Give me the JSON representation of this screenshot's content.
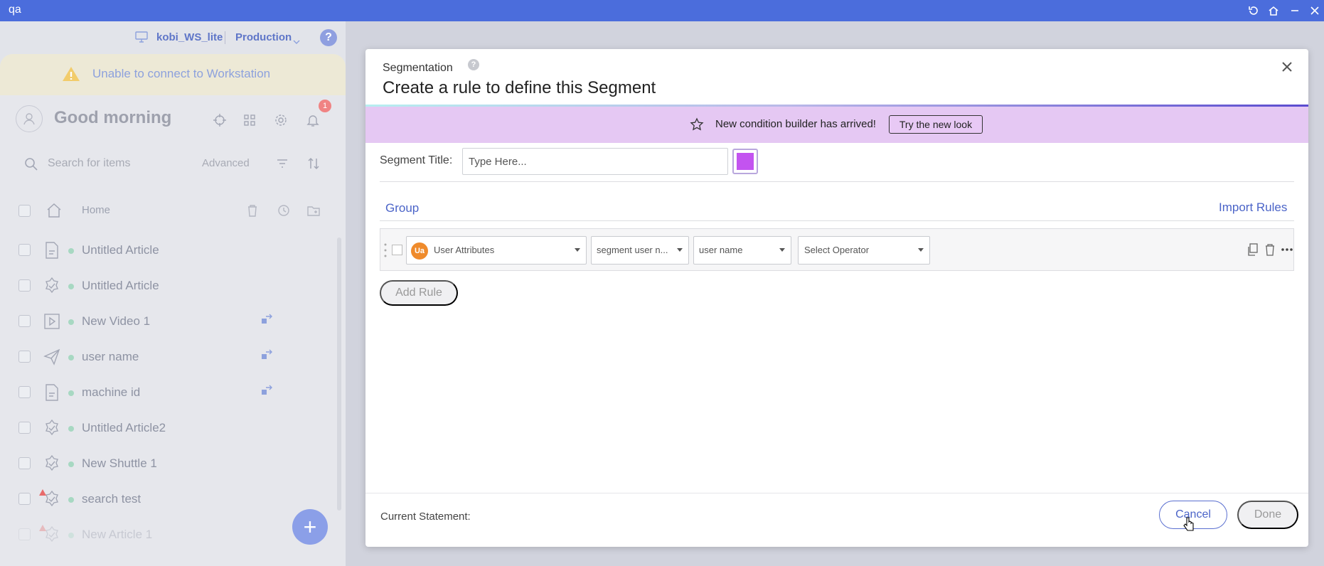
{
  "window": {
    "title": "qa"
  },
  "sidebar": {
    "workstation_name": "kobi_WS_lite",
    "environment": "Production",
    "help": "?",
    "warning": "Unable to connect to Workstation",
    "greeting": "Good morning",
    "notification_count": "1",
    "search": {
      "placeholder": "Search for items",
      "advanced_label": "Advanced"
    },
    "home_label": "Home",
    "items": [
      {
        "label": "Untitled Article",
        "type_icon": "article-icon"
      },
      {
        "label": "Untitled Article",
        "type_icon": "shuttle-icon"
      },
      {
        "label": "New Video 1",
        "type_icon": "video-icon"
      },
      {
        "label": "user name",
        "type_icon": "send-icon"
      },
      {
        "label": "machine id",
        "type_icon": "article-icon"
      },
      {
        "label": "Untitled Article2",
        "type_icon": "shuttle-icon"
      },
      {
        "label": "New Shuttle 1",
        "type_icon": "shuttle-icon"
      },
      {
        "label": "search test",
        "type_icon": "shuttle-icon"
      },
      {
        "label": "New Article 1",
        "type_icon": "shuttle-icon"
      }
    ],
    "fab_label": "+"
  },
  "modal": {
    "subtitle": "Segmentation",
    "help": "?",
    "title": "Create a rule to define this Segment",
    "banner": {
      "text": "New condition builder has arrived!",
      "button": "Try the new look"
    },
    "segment_title": {
      "label": "Segment Title:",
      "placeholder": "Type Here..."
    },
    "segment_color": "#c353f0",
    "group_label": "Group",
    "import_label": "Import Rules",
    "rule": {
      "badge": "Ua",
      "attribute_type": "User Attributes",
      "attribute_source": "segment user n...",
      "attribute_field": "user name",
      "operator": "Select Operator"
    },
    "add_rule": "Add Rule",
    "current_statement": "Current Statement:",
    "cancel": "Cancel",
    "done": "Done"
  },
  "colors": {
    "titlebar": "#4b6ddc",
    "accent": "#4b64c8",
    "banner": "#e5c8f3",
    "ua_badge": "#ef8b2c"
  }
}
